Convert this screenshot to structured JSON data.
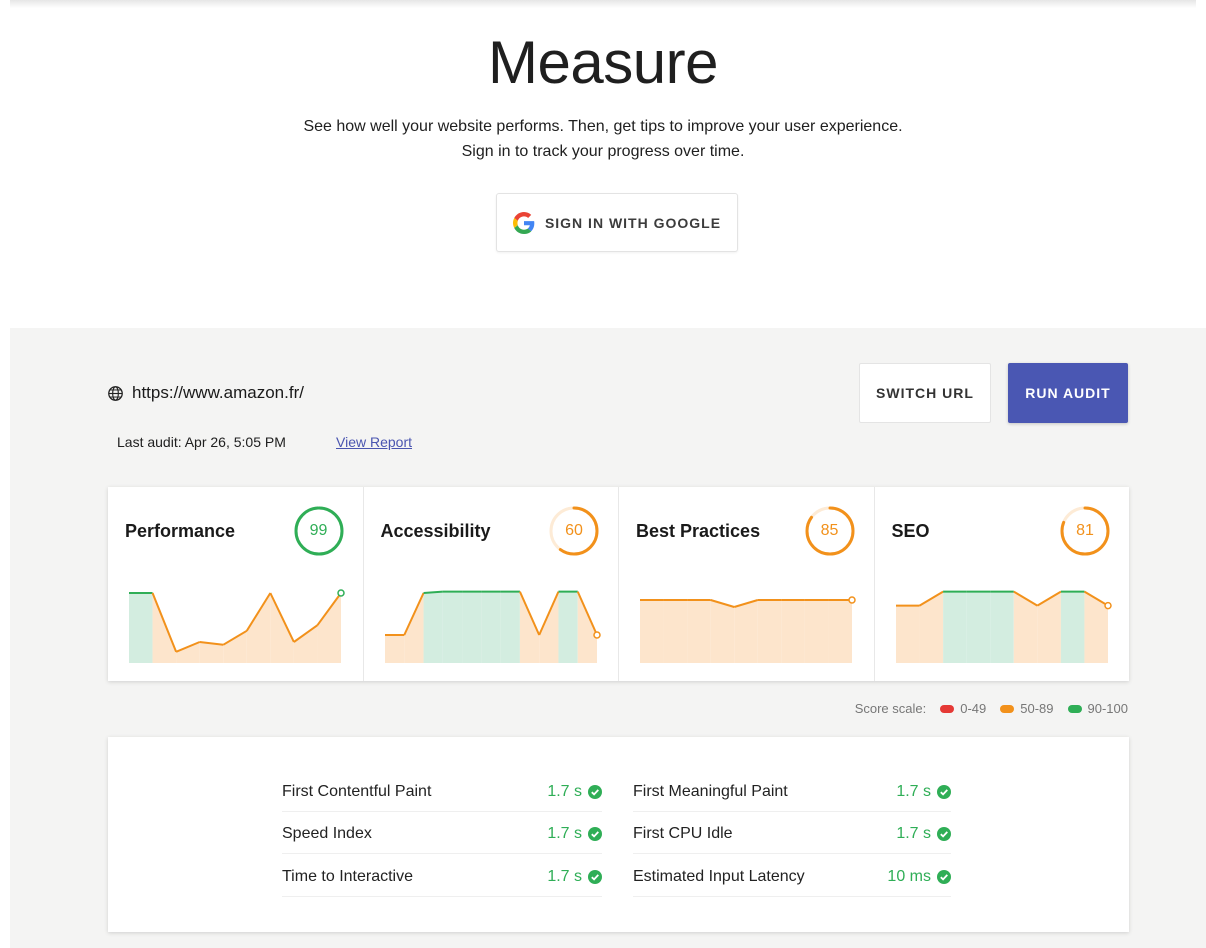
{
  "hero": {
    "title": "Measure",
    "line1": "See how well your website performs. Then, get tips to improve your user experience.",
    "line2": "Sign in to track your progress over time.",
    "signin_label": "SIGN IN WITH GOOGLE"
  },
  "audit": {
    "url": "https://www.amazon.fr/",
    "last_audit": "Last audit: Apr 26, 5:05 PM",
    "view_report": "View Report",
    "switch_url": "SWITCH URL",
    "run_audit": "RUN AUDIT"
  },
  "colors": {
    "good": "#2fae56",
    "average": "#f2911b",
    "poor": "#e53935",
    "good_fill": "#d3ede0",
    "average_fill": "#fde5cc",
    "accent": "#4a57b3"
  },
  "categories": [
    {
      "title": "Performance",
      "score": "99",
      "status": "good",
      "history": [
        90,
        90,
        48,
        55,
        53,
        63,
        90,
        55,
        67,
        90
      ]
    },
    {
      "title": "Accessibility",
      "score": "60",
      "status": "average",
      "history": [
        60,
        60,
        90,
        91,
        91,
        91,
        91,
        91,
        60,
        91,
        91,
        60
      ]
    },
    {
      "title": "Best Practices",
      "score": "85",
      "status": "average",
      "history": [
        85,
        85,
        85,
        85,
        80,
        85,
        85,
        85,
        85,
        85
      ]
    },
    {
      "title": "SEO",
      "score": "81",
      "status": "average",
      "history": [
        81,
        81,
        91,
        91,
        91,
        91,
        81,
        91,
        91,
        81
      ]
    }
  ],
  "legend": {
    "label": "Score scale:",
    "ranges": [
      "0-49",
      "50-89",
      "90-100"
    ]
  },
  "metrics": [
    {
      "name": "First Contentful Paint",
      "value": "1.7 s"
    },
    {
      "name": "First Meaningful Paint",
      "value": "1.7 s"
    },
    {
      "name": "Speed Index",
      "value": "1.7 s"
    },
    {
      "name": "First CPU Idle",
      "value": "1.7 s"
    },
    {
      "name": "Time to Interactive",
      "value": "1.7 s"
    },
    {
      "name": "Estimated Input Latency",
      "value": "10 ms"
    }
  ]
}
